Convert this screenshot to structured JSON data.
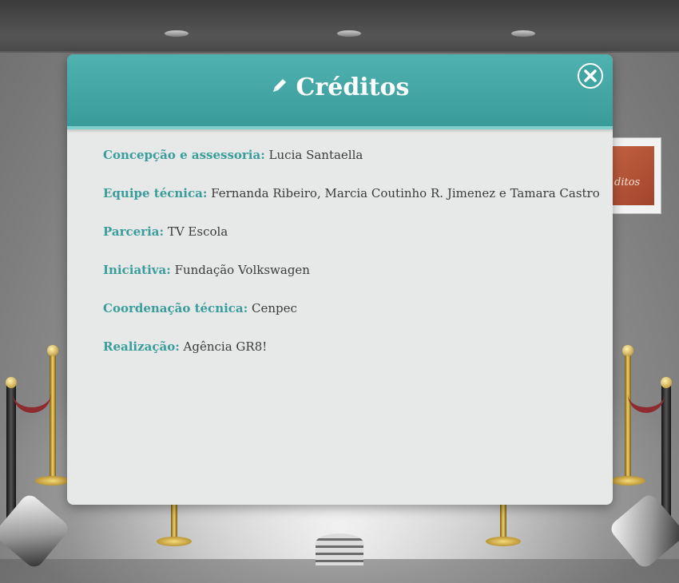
{
  "dialog": {
    "title": "Créditos",
    "title_icon": "pencil-icon",
    "close_icon": "close-icon",
    "accent_color": "#3a9d9b"
  },
  "credits": [
    {
      "label": "Concepção e assessoria:",
      "value": "Lucia Santaella"
    },
    {
      "label": "Equipe técnica:",
      "value": "Fernanda Ribeiro, Marcia Coutinho R. Jimenez e Tamara Castro"
    },
    {
      "label": "Parceria:",
      "value": "TV Escola"
    },
    {
      "label": "Iniciativa:",
      "value": "Fundação Volkswagen"
    },
    {
      "label": "Coordenação técnica:",
      "value": "Cenpec"
    },
    {
      "label": "Realização:",
      "value": "Agência GR8!"
    }
  ],
  "background": {
    "frame_text": "ditos"
  }
}
